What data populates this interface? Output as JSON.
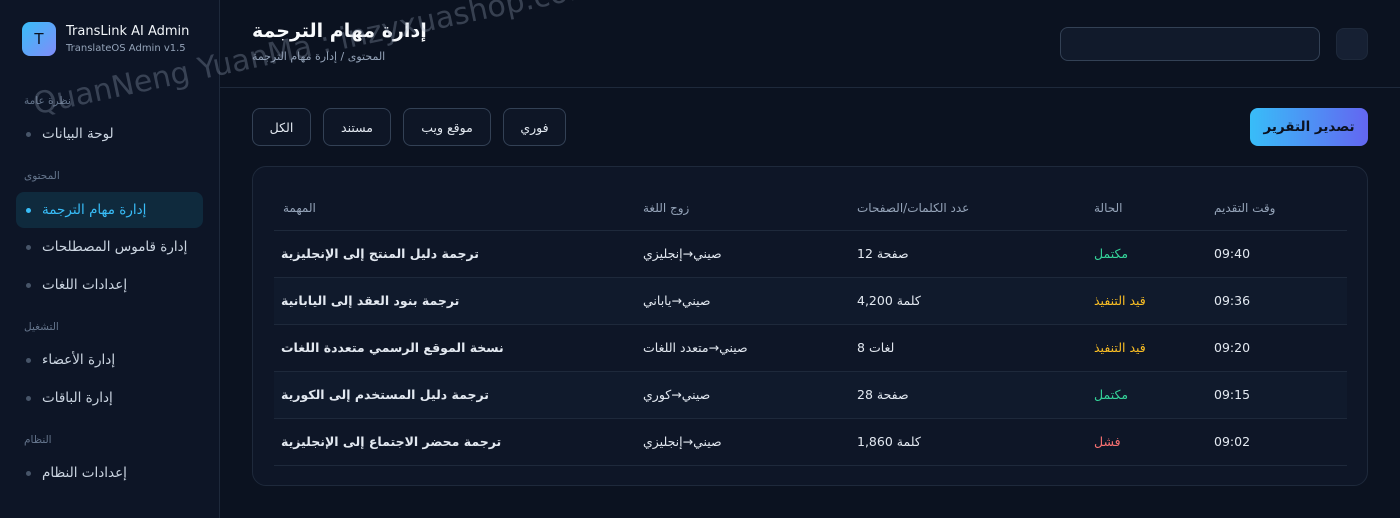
{
  "app": {
    "title": "TransLink AI Admin",
    "subtitle": "TranslateOS Admin v1.5",
    "logo_letter": "T"
  },
  "sidebar": {
    "sections": [
      {
        "label": "نظرة عامة",
        "items": [
          {
            "label": "لوحة البيانات",
            "active": false
          }
        ]
      },
      {
        "label": "المحتوى",
        "items": [
          {
            "label": "إدارة مهام الترجمة",
            "active": true
          },
          {
            "label": "إدارة قاموس المصطلحات",
            "active": false
          },
          {
            "label": "إعدادات اللغات",
            "active": false
          }
        ]
      },
      {
        "label": "التشغيل",
        "items": [
          {
            "label": "إدارة الأعضاء",
            "active": false
          },
          {
            "label": "إدارة الباقات",
            "active": false
          }
        ]
      },
      {
        "label": "النظام",
        "items": [
          {
            "label": "إعدادات النظام",
            "active": false
          }
        ]
      }
    ]
  },
  "header": {
    "title": "إدارة مهام الترجمة",
    "breadcrumb": "المحتوى / إدارة مهام الترجمة",
    "search_placeholder": ""
  },
  "filters": {
    "all": "الكل",
    "document": "مستند",
    "website": "موقع ويب",
    "instant": "فوري"
  },
  "actions": {
    "export": "تصدير التقرير"
  },
  "table": {
    "columns": [
      "المهمة",
      "زوج اللغة",
      "عدد الكلمات/الصفحات",
      "الحالة",
      "وقت التقديم"
    ],
    "rows": [
      {
        "task": "ترجمة دليل المنتج إلى الإنجليزية",
        "pair": "صيني→إنجليزي",
        "amount": "12 صفحة",
        "status": "مكتمل",
        "status_color": "#34d399",
        "time": "09:40"
      },
      {
        "task": "ترجمة بنود العقد إلى اليابانية",
        "pair": "صيني→ياباني",
        "amount": "4,200 كلمة",
        "status": "قيد التنفيذ",
        "status_color": "#fbbf24",
        "time": "09:36"
      },
      {
        "task": "نسخة الموقع الرسمي متعددة اللغات",
        "pair": "صيني→متعدد اللغات",
        "amount": "8 لغات",
        "status": "قيد التنفيذ",
        "status_color": "#fbbf24",
        "time": "09:20"
      },
      {
        "task": "ترجمة دليل المستخدم إلى الكورية",
        "pair": "صيني→كوري",
        "amount": "28 صفحة",
        "status": "مكتمل",
        "status_color": "#34d399",
        "time": "09:15"
      },
      {
        "task": "ترجمة محضر الاجتماع إلى الإنجليزية",
        "pair": "صيني→إنجليزي",
        "amount": "1,860 كلمة",
        "status": "فشل",
        "status_color": "#f87171",
        "time": "09:02"
      }
    ]
  },
  "watermark": "QuanNeng YuanMa : inzyxuashop.com"
}
